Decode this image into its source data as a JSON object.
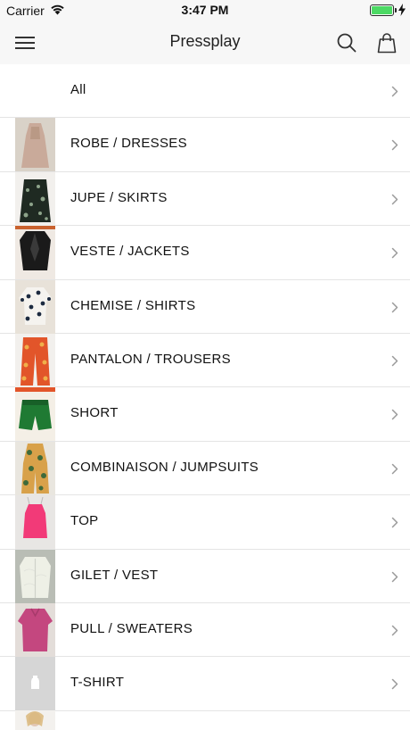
{
  "status_bar": {
    "carrier": "Carrier",
    "time": "3:47 PM",
    "battery_color": "#4cd964"
  },
  "nav": {
    "title": "Pressplay",
    "icons": [
      "menu-icon",
      "search-icon",
      "shopping-bag-icon"
    ]
  },
  "categories": [
    {
      "label": "All",
      "thumb": "none",
      "thumb_colors": []
    },
    {
      "label": "ROBE / DRESSES",
      "thumb": "dress",
      "thumb_colors": [
        "#c9aa9a",
        "#a9876f"
      ]
    },
    {
      "label": "JUPE / SKIRTS",
      "thumb": "skirt",
      "thumb_colors": [
        "#1f2a22",
        "#8da48a"
      ]
    },
    {
      "label": "VESTE / JACKETS",
      "thumb": "jacket",
      "thumb_colors": [
        "#1a1a1a",
        "#c9622f"
      ]
    },
    {
      "label": "CHEMISE / SHIRTS",
      "thumb": "shirt",
      "thumb_colors": [
        "#1c2a40",
        "#e8e2d9"
      ]
    },
    {
      "label": "PANTALON / TROUSERS",
      "thumb": "trousers",
      "thumb_colors": [
        "#e2552a",
        "#f0b04a"
      ]
    },
    {
      "label": "SHORT",
      "thumb": "shorts",
      "thumb_colors": [
        "#1f7a33",
        "#e6d3a8"
      ]
    },
    {
      "label": "COMBINAISON / JUMPSUITS",
      "thumb": "jumpsuit",
      "thumb_colors": [
        "#d8a14a",
        "#3e6a3a"
      ]
    },
    {
      "label": "TOP",
      "thumb": "top",
      "thumb_colors": [
        "#f23a78",
        "#e8e6e4"
      ]
    },
    {
      "label": "GILET / VEST",
      "thumb": "gilet",
      "thumb_colors": [
        "#eef0e6",
        "#b9bdb5"
      ]
    },
    {
      "label": "PULL / SWEATERS",
      "thumb": "sweater",
      "thumb_colors": [
        "#c4477f",
        "#e3ddd9"
      ]
    },
    {
      "label": "T-SHIRT",
      "thumb": "placeholder",
      "thumb_colors": [
        "#d6d6d6",
        "#ffffff"
      ]
    }
  ]
}
